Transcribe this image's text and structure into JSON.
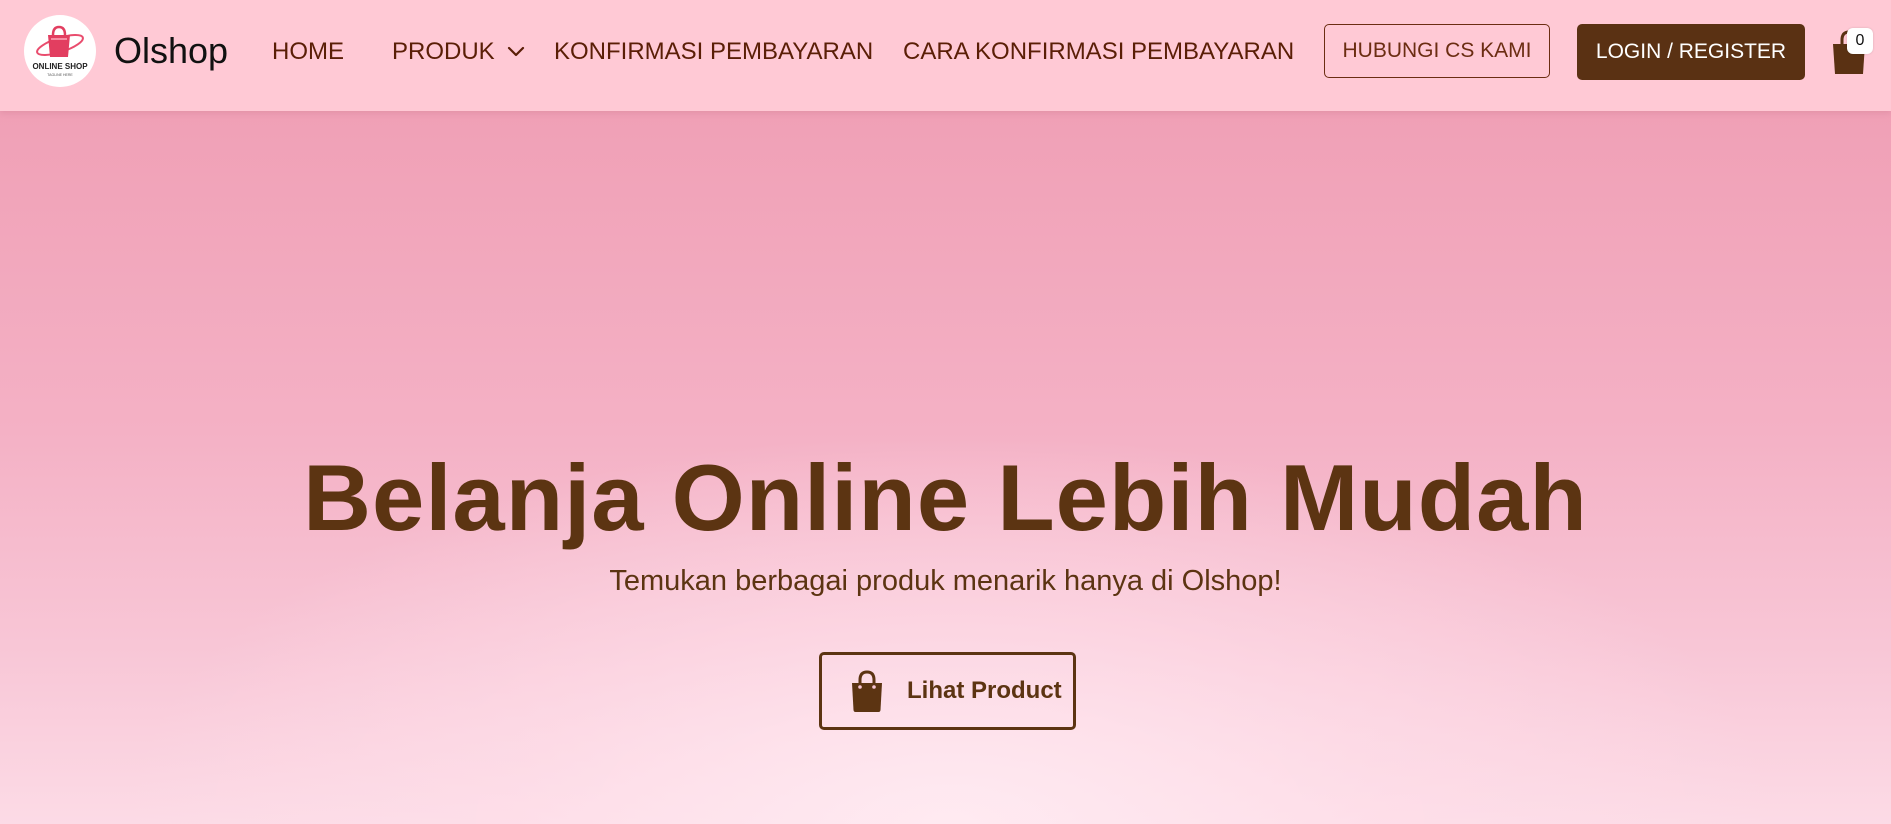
{
  "navbar": {
    "logo_icon": "shopping-bag-logo-icon",
    "logo_text": "ONLINE SHOP",
    "logo_tagline": "TAGLINE HERE",
    "brand": "Olshop",
    "links": {
      "home": "HOME",
      "produk": "PRODUK",
      "konfirmasi": "KONFIRMASI PEMBAYARAN",
      "cara": "CARA KONFIRMASI PEMBAYARAN"
    },
    "cs_button": "HUBUNGI CS KAMI",
    "login_button": "LOGIN / REGISTER",
    "cart_icon": "shopping-bag-icon",
    "cart_count": "0"
  },
  "hero": {
    "title": "Belanja Online Lebih Mudah",
    "subtitle": "Temukan berbagai produk menarik hanya di Olshop!",
    "cta_label": "Lihat Product",
    "cta_icon": "shopping-bag-icon"
  },
  "colors": {
    "navbar_bg": "#ffc9d5",
    "accent_brown": "#5a3113",
    "hero_text": "#5c3412",
    "hero_bg_top": "#f0a0b6",
    "hero_bg_bottom": "#fcdbe6"
  }
}
